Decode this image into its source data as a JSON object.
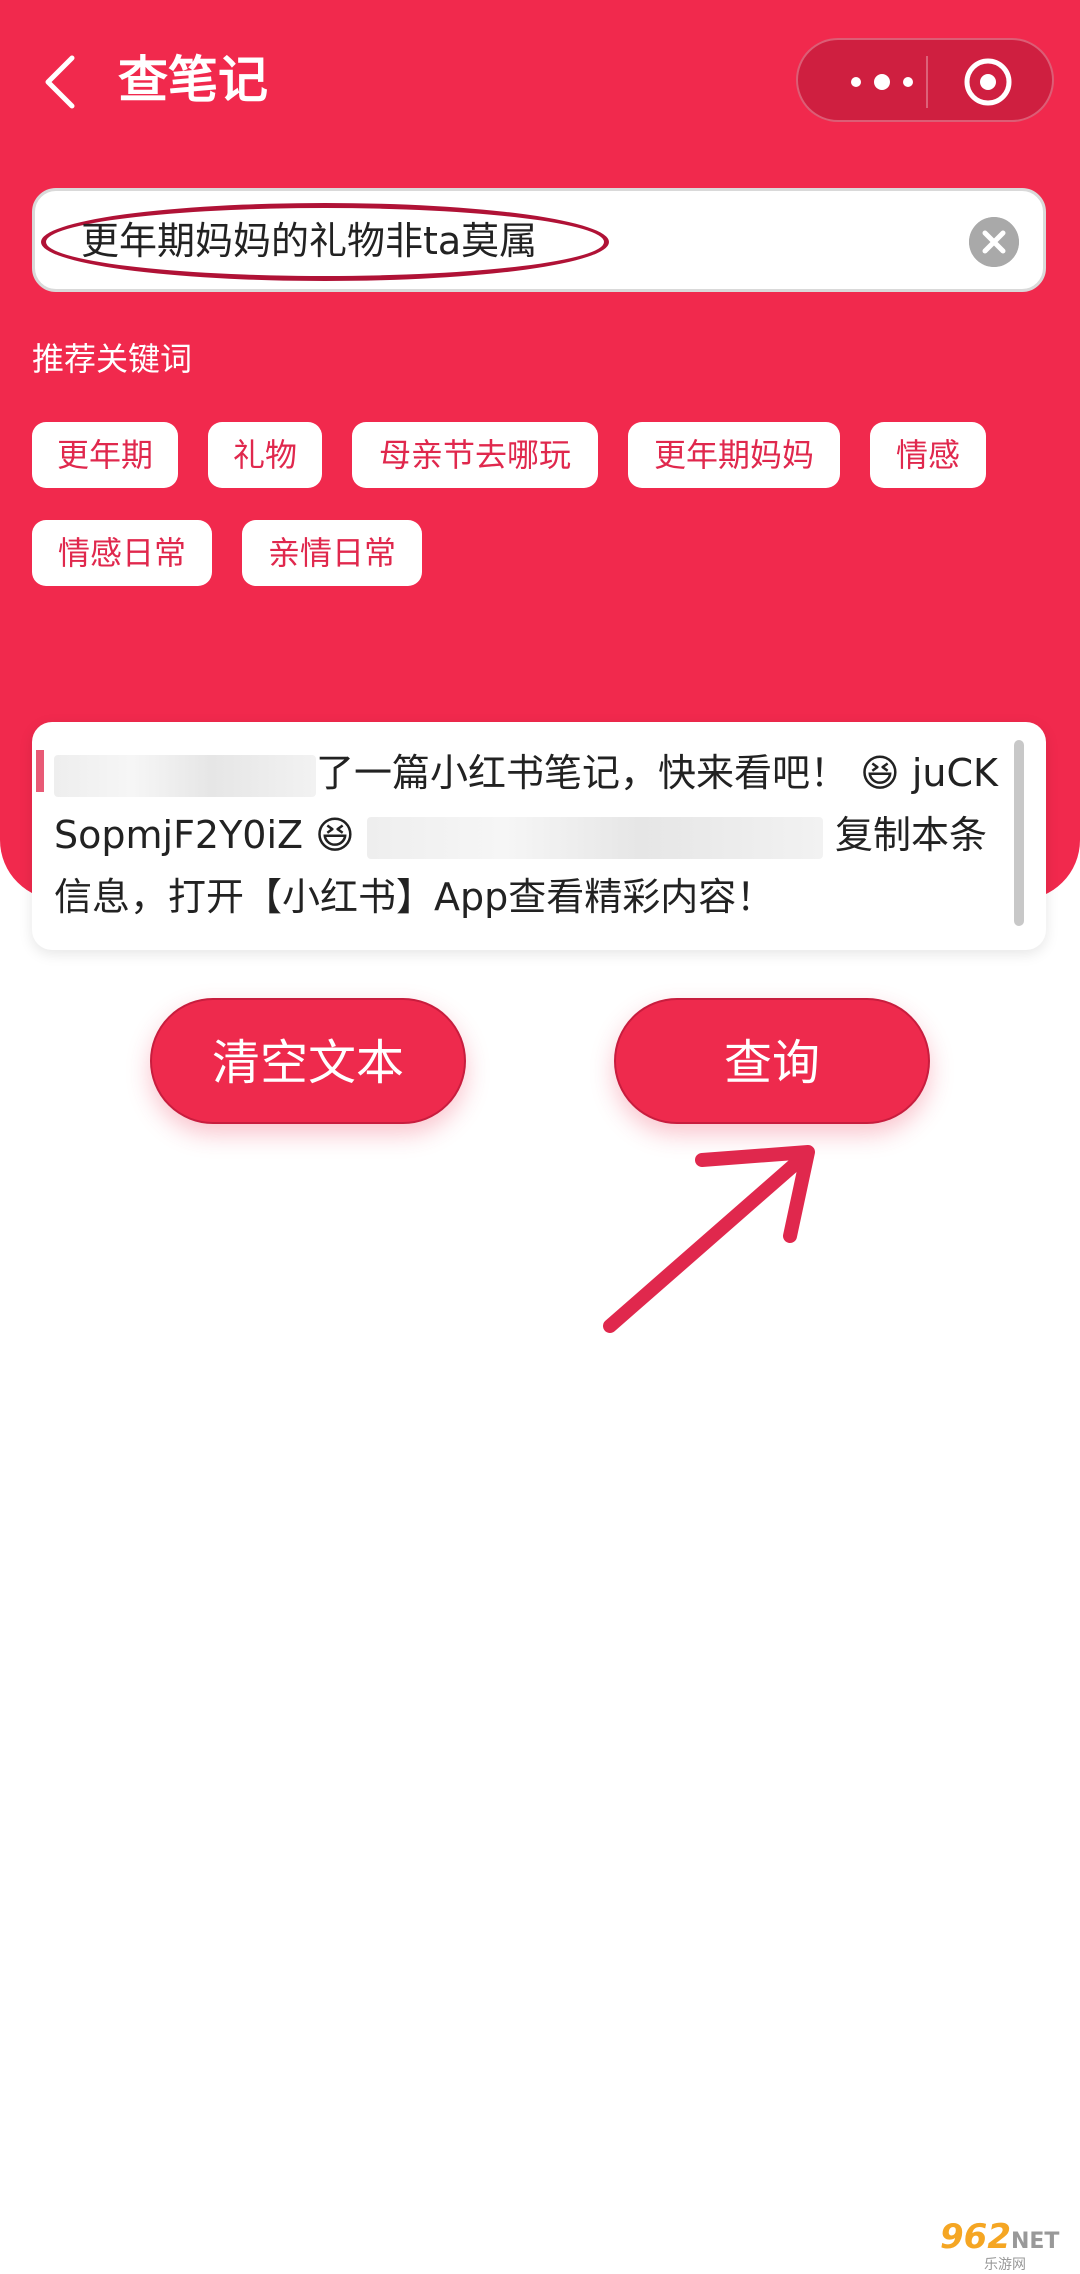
{
  "header": {
    "title": "查笔记",
    "back_icon": "chevron-left-icon",
    "more_icon": "more-dots-icon",
    "target_icon": "target-icon"
  },
  "search": {
    "value": "更年期妈妈的礼物非ta莫属",
    "clear_icon": "clear-circle-icon"
  },
  "recommend": {
    "label": "推荐关键词",
    "chips": [
      "更年期",
      "礼物",
      "母亲节去哪玩",
      "更年期妈妈",
      "情感",
      "情感日常",
      "亲情日常"
    ]
  },
  "share_text": {
    "line1_visible": "了一篇小红书笔记，快来看吧！",
    "emoji": "😆",
    "line1_code": "juCK",
    "line2_code": "SopmjF2Y0iZ",
    "line2_suffix": "复制本条",
    "line3": "信息，打开【小红书】App查看精彩内容！"
  },
  "buttons": {
    "clear": "清空文本",
    "query": "查询"
  },
  "watermark": {
    "brand": "962",
    "net": "NET",
    "sub": "乐游网"
  },
  "colors": {
    "primary": "#f1294d",
    "button": "#ee2a4d",
    "annotation": "#e0284d"
  }
}
